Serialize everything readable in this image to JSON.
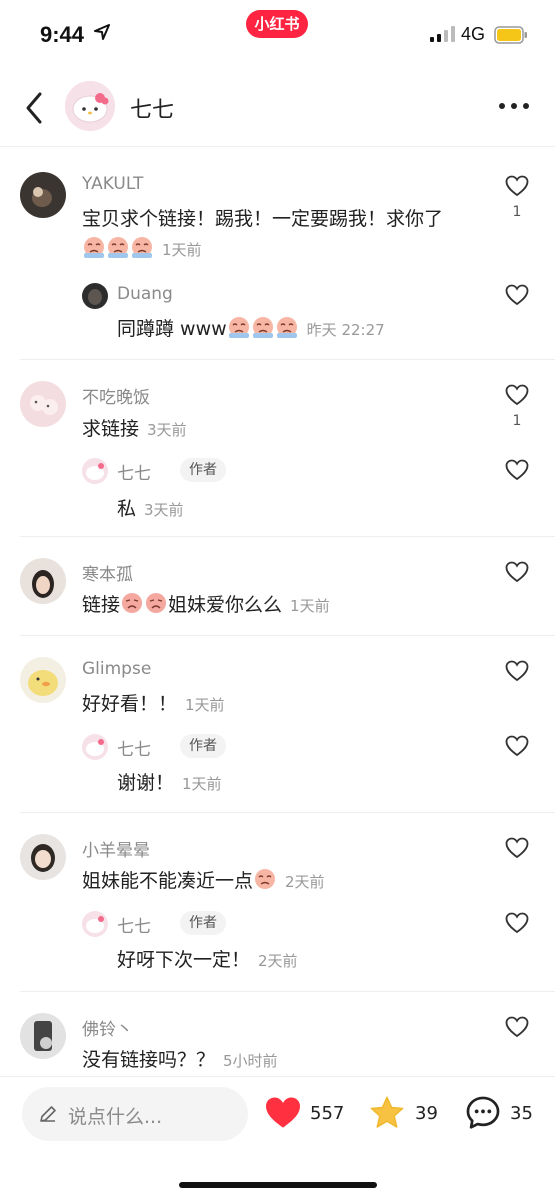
{
  "status_bar": {
    "time": "9:44",
    "app_badge": "小红书",
    "network": "4G"
  },
  "header": {
    "title": "七七"
  },
  "comments": [
    {
      "user": "YAKULT",
      "text": "宝贝求个链接！踢我！一定要踢我！求你了",
      "time": "1天前",
      "likes": "1",
      "replies": [
        {
          "user": "Duang",
          "text": "同蹲蹲 www",
          "time": "昨天 22:27"
        }
      ]
    },
    {
      "user": "不吃晚饭",
      "text": "求链接",
      "time": "3天前",
      "likes": "1",
      "replies": [
        {
          "user": "七七",
          "tag": "作者",
          "text": "私",
          "time": "3天前"
        }
      ]
    },
    {
      "user": "寒本孤",
      "text_a": "链接",
      "text_b": "姐妹爱你么么",
      "time": "1天前"
    },
    {
      "user": "Glimpse",
      "text": "好好看！！",
      "time": "1天前",
      "replies": [
        {
          "user": "七七",
          "tag": "作者",
          "text": "谢谢！",
          "time": "1天前"
        }
      ]
    },
    {
      "user": "小羊晕晕",
      "text": "姐妹能不能凑近一点",
      "time": "2天前",
      "replies": [
        {
          "user": "七七",
          "tag": "作者",
          "text": "好呀下次一定！",
          "time": "2天前"
        }
      ]
    },
    {
      "user": "佛铃丶",
      "text": "没有链接吗？？",
      "time": "5小时前"
    }
  ],
  "bottom_bar": {
    "input_placeholder": "说点什么...",
    "likes": "557",
    "collects": "39",
    "comments": "35"
  },
  "colors": {
    "brand_red": "#ff2442",
    "star_yellow": "#f7c241",
    "heart_red": "#ff3040"
  },
  "icons": [
    "location-arrow-icon",
    "signal-icon",
    "battery-icon",
    "back-arrow-icon",
    "more-dots-icon",
    "heart-outline-icon",
    "crying-emoji-icon",
    "pencil-icon",
    "heart-filled-icon",
    "star-filled-icon",
    "comment-bubble-icon"
  ]
}
